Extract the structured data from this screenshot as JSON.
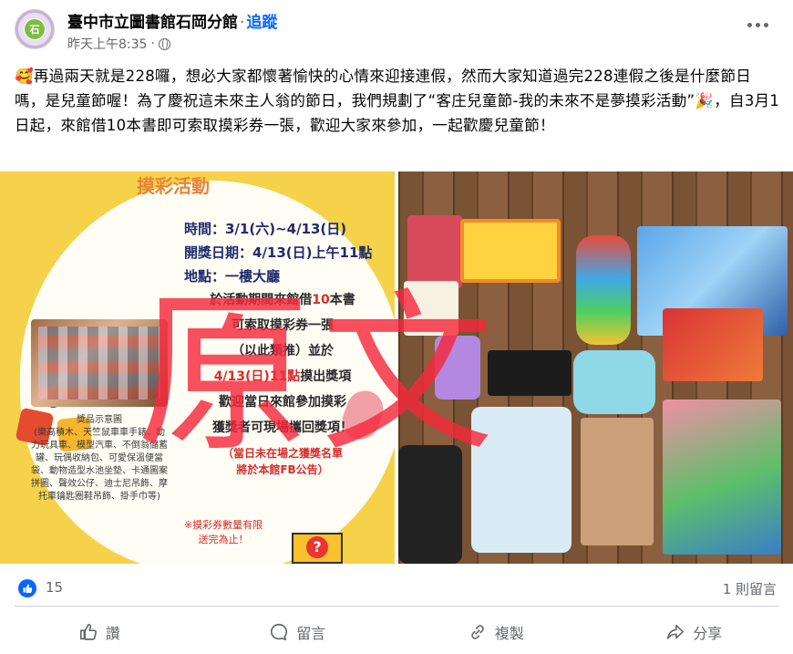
{
  "header": {
    "page_name": "臺中市立圖書館石岡分館",
    "separator": "·",
    "follow_label": "追蹤",
    "timestamp": "昨天上午8:35",
    "avatar_text": "石"
  },
  "post": {
    "emoji_start": "🥰",
    "text_main": "再過兩天就是228囉，想必大家都懷著愉快的心情來迎接連假，然而大家知道過完228連假之後是什麼節日嗎，是兒童節喔！為了慶祝這未來主人翁的節日，我們規劃了“客庄兒童節-我的未來不是夢摸彩活動”",
    "emoji_mid": "🎉",
    "text_end": "，自3月1日起，來館借10本書即可索取摸彩券一張，歡迎大家來參加，一起歡慶兒童節！"
  },
  "poster": {
    "title": "摸彩活動",
    "time_line": "時間：3/1(六)~4/13(日)",
    "draw_line": "開獎日期：4/13(日)上午11點",
    "place_line": "地點：一樓大廳",
    "body_1a": "於活動期間來館借",
    "body_1b": "10",
    "body_1c": "本書",
    "body_2": "可索取摸彩券一張",
    "body_3": "（以此類推）並於",
    "body_4a": "4/13(日)11點",
    "body_4b": "摸出獎項",
    "body_5": "歡迎當日來館參加摸彩",
    "body_6": "獲獎者可現場攜回獎項！",
    "note_1": "（當日未在場之獲獎名單",
    "note_2": "將於本館FB公告）",
    "sample_caption": "獎品示意圖\n(樂高積木、天竺鼠車車手錶、動力玩具車、模型汽車、不倒翁儲蓄罐、玩偶收納包、可愛保溫便當袋、動物造型水池坐墊、卡通圖案拼圖、聲效公仔、迪士尼吊飾、摩托車鑰匙圈鞋吊飾、掛手巾等)",
    "limit_1": "※摸彩券數量有限",
    "limit_2": "送完為止！",
    "gift_mark": "?"
  },
  "watermark": "原文",
  "reactions": {
    "like_count": "15",
    "comment_count": "1 則留言"
  },
  "actions": {
    "like_label": "讚",
    "comment_label": "留言",
    "copy_label": "複製",
    "share_label": "分享"
  },
  "colors": {
    "accent": "#0866ff",
    "muted": "#65676b",
    "watermark": "#f5283c"
  }
}
